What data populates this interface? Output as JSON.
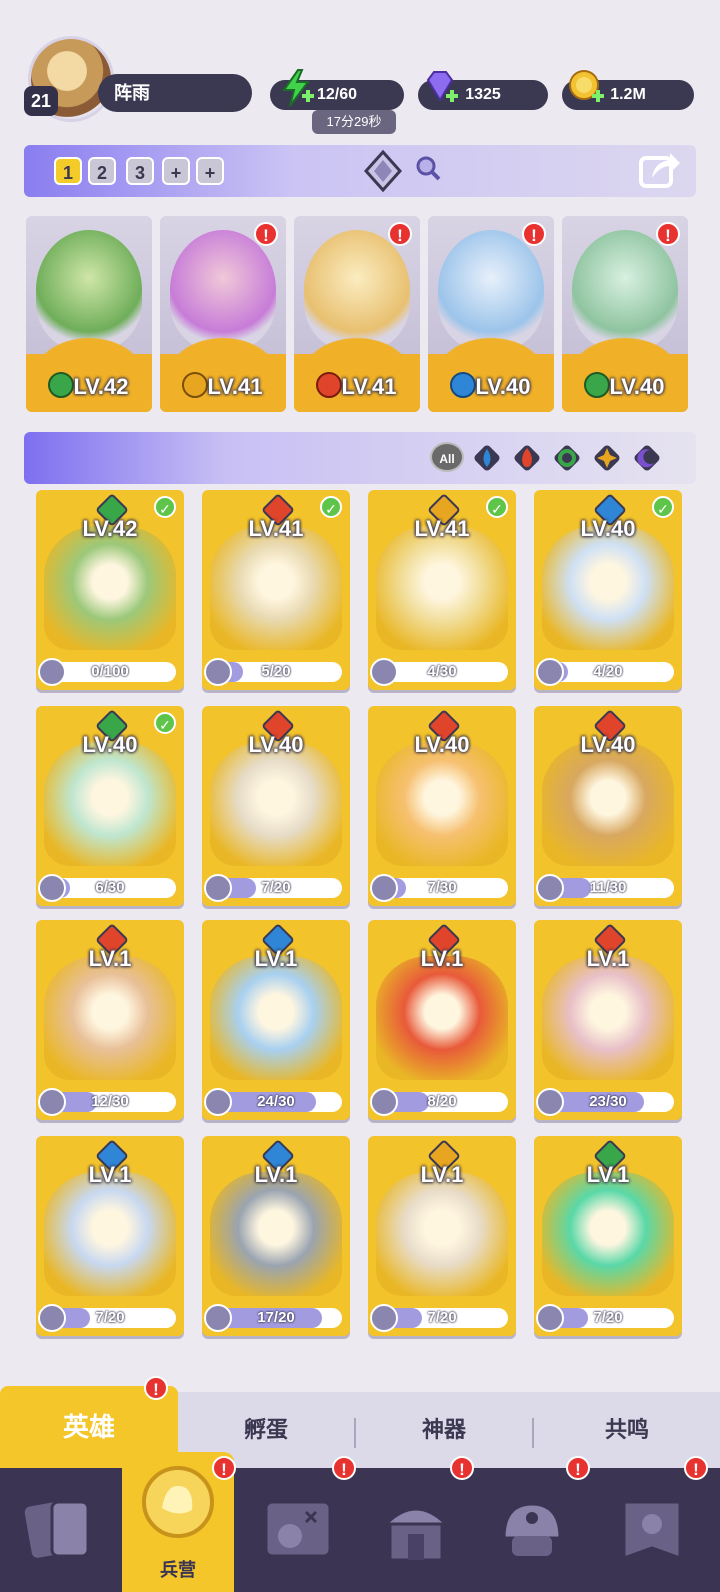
{
  "player": {
    "level": "21",
    "name": "阵雨"
  },
  "resources": {
    "energy": "12/60",
    "energy_timer": "17分29秒",
    "gems": "1325",
    "gold": "1.2M"
  },
  "teams": {
    "tabs": [
      "1",
      "2",
      "3",
      "+",
      "+"
    ],
    "active": "1"
  },
  "team_slots": [
    {
      "level": "LV.42",
      "element": "nature"
    },
    {
      "level": "LV.41",
      "element": "light"
    },
    {
      "level": "LV.41",
      "element": "fire"
    },
    {
      "level": "LV.40",
      "element": "water"
    },
    {
      "level": "LV.40",
      "element": "nature"
    }
  ],
  "filters": {
    "all": "All",
    "elements": [
      "water",
      "fire",
      "nature",
      "light",
      "dark"
    ]
  },
  "heroes": [
    {
      "level": "LV.42",
      "progress": "0/100",
      "fraction": 0.0,
      "element": "nature"
    },
    {
      "level": "LV.41",
      "progress": "5/20",
      "fraction": 0.25,
      "element": "fire"
    },
    {
      "level": "LV.41",
      "progress": "4/30",
      "fraction": 0.13,
      "element": "light"
    },
    {
      "level": "LV.40",
      "progress": "4/20",
      "fraction": 0.2,
      "element": "water"
    },
    {
      "level": "LV.40",
      "progress": "6/30",
      "fraction": 0.2,
      "element": "nature"
    },
    {
      "level": "LV.40",
      "progress": "7/20",
      "fraction": 0.35,
      "element": "fire"
    },
    {
      "level": "LV.40",
      "progress": "7/30",
      "fraction": 0.23,
      "element": "fire"
    },
    {
      "level": "LV.40",
      "progress": "11/30",
      "fraction": 0.37,
      "element": "fire"
    },
    {
      "level": "LV.1",
      "progress": "12/30",
      "fraction": 0.4,
      "element": "fire"
    },
    {
      "level": "LV.1",
      "progress": "24/30",
      "fraction": 0.8,
      "element": "water"
    },
    {
      "level": "LV.1",
      "progress": "8/20",
      "fraction": 0.4,
      "element": "fire"
    },
    {
      "level": "LV.1",
      "progress": "23/30",
      "fraction": 0.77,
      "element": "fire"
    },
    {
      "level": "LV.1",
      "progress": "7/20",
      "fraction": 0.35,
      "element": "water"
    },
    {
      "level": "LV.1",
      "progress": "17/20",
      "fraction": 0.85,
      "element": "water"
    },
    {
      "level": "LV.1",
      "progress": "7/20",
      "fraction": 0.35,
      "element": "light"
    },
    {
      "level": "LV.1",
      "progress": "7/20",
      "fraction": 0.35,
      "element": "nature"
    }
  ],
  "subtabs": [
    "英雄",
    "孵蛋",
    "神器",
    "共鸣"
  ],
  "nav": {
    "active_label": "兵营"
  },
  "colors": {
    "fire": "#e0452c",
    "water": "#2f86d6",
    "nature": "#3aa64a",
    "light": "#e8a51f",
    "dark": "#7b4fd0",
    "accent": "#f4c62a"
  }
}
